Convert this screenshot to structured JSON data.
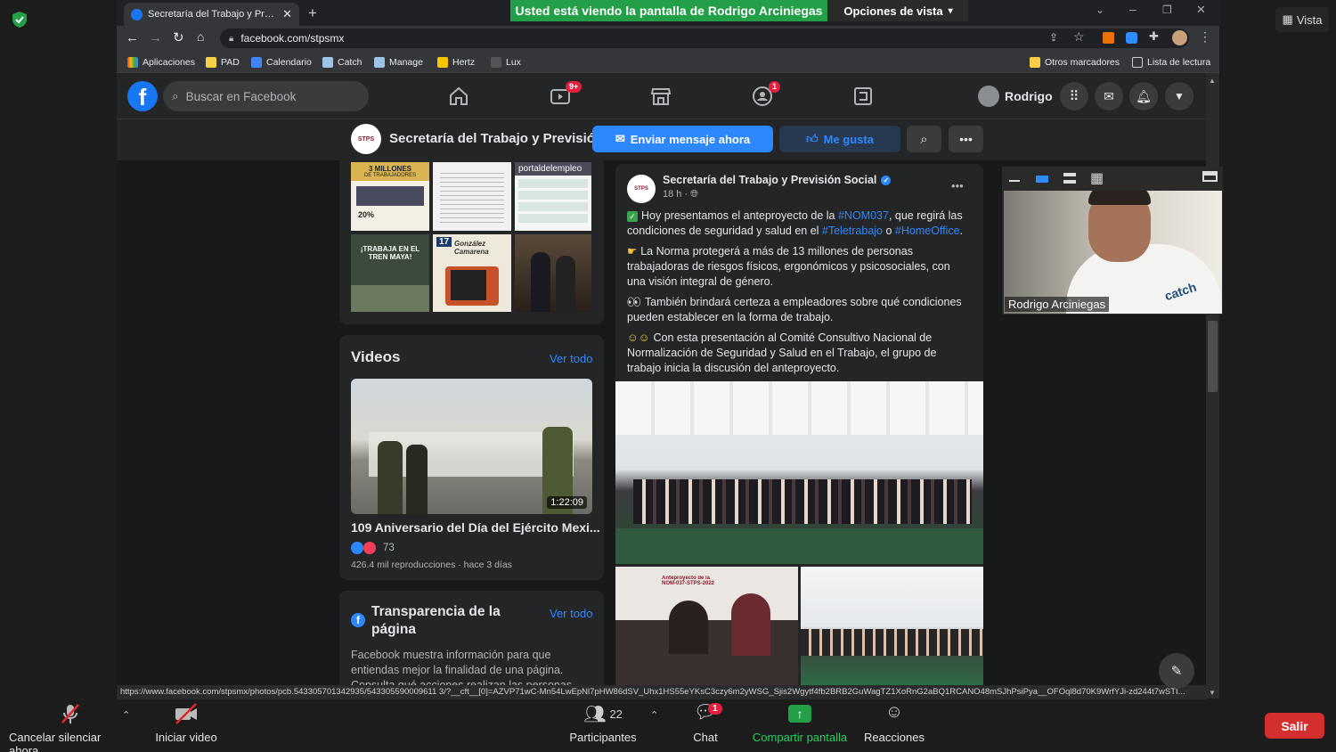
{
  "zoom": {
    "banner": "Usted está viendo la pantalla de Rodrigo Arciniegas",
    "view_options": "Opciones de vista",
    "vista": "Vista",
    "participant_name": "Rodrigo Arciniegas",
    "toolbar": {
      "mute": "Cancelar silenciar ahora",
      "video": "Iniciar video",
      "participants": "Participantes",
      "participants_count": "22",
      "chat": "Chat",
      "chat_badge": "1",
      "share": "Compartir pantalla",
      "reactions": "Reacciones",
      "leave": "Salir"
    },
    "colors": {
      "green": "#23a047",
      "leave": "#d32f2f"
    }
  },
  "browser": {
    "tab_title": "Secretaría del Trabajo y Previsión",
    "url": "facebook.com/stpsmx",
    "bookmarks": [
      "Aplicaciones",
      "PAD",
      "Calendario",
      "Catch",
      "Manage",
      "Hertz",
      "Lux"
    ],
    "other_bookmarks": "Otros marcadores",
    "reading_list": "Lista de lectura",
    "status_url": "https://www.facebook.com/stpsmx/photos/pcb.543305701342935/543305590009611 3/?__cft__[0]=AZVP71wC-Mn54LwEpNl7pHW86dSV_Uhx1HS55eYKsC3czy6m2yWSG_Sjis2Wgytf4fb2BRB2GuWagTZ1XoRnG2aBQ1RCANO48mSJhPsiPya__OFOql8d70K9WrfYJi-zd244t7wSTI..."
  },
  "facebook": {
    "search_placeholder": "Buscar en Facebook",
    "user_name": "Rodrigo",
    "watch_badge": "9+",
    "groups_badge": "1",
    "page_name": "Secretaría del Trabajo y Previsió...",
    "send_message": "Enviar mensaje ahora",
    "like": "Me gusta",
    "photos": {
      "millones_title": "3 MILLONES",
      "millones_sub": "DE TRABAJADORES",
      "millones_pct": "20%",
      "portal": "portaldelempleo",
      "tren": "¡TRABAJA EN EL TREN MAYA!",
      "gonzalez_day": "17",
      "gonzalez": "González Camarena"
    },
    "videos": {
      "title": "Videos",
      "see_all": "Ver todo",
      "duration": "1:22:09",
      "video_title": "109 Aniversario del Día del Ejército Mexi...",
      "reactions": "73",
      "meta": "426.4 mil reproducciones · hace 3 días"
    },
    "transparency": {
      "title": "Transparencia de la página",
      "see_all": "Ver todo",
      "text": "Facebook muestra información para que entiendas mejor la finalidad de una página.",
      "text_cut": "Consulta qué acciones realizan las personas"
    },
    "post": {
      "author": "Secretaría del Trabajo y Previsión Social",
      "time": "18 h ·",
      "p1_pre": "Hoy presentamos el anteproyecto de la ",
      "p1_tag1": "#NOM037",
      "p1_mid": ", que regirá las condiciones de seguridad y salud en el ",
      "p1_tag2": "#Teletrabajo",
      "p1_or": " o ",
      "p1_tag3": "#HomeOffice",
      "p1_end": ".",
      "p2": "La Norma protegerá a más de 13 millones de personas trabajadoras de riesgos físicos, ergonómicos y psicosociales, con una visión integral de género.",
      "p3": "También brindará certeza a empleadores sobre qué condiciones pueden establecer en la forma de trabajo.",
      "p4": "Con esta presentación al Comité Consultivo Nacional de Normalización de Seguridad y Salud en el Trabajo, el grupo de trabajo inicia la discusión del anteproyecto.",
      "sign_text": "Anteproyecto de la NOM-037-STPS-2022"
    },
    "colors": {
      "blue": "#2d88ff",
      "bg": "#18191a",
      "card": "#242526"
    }
  }
}
